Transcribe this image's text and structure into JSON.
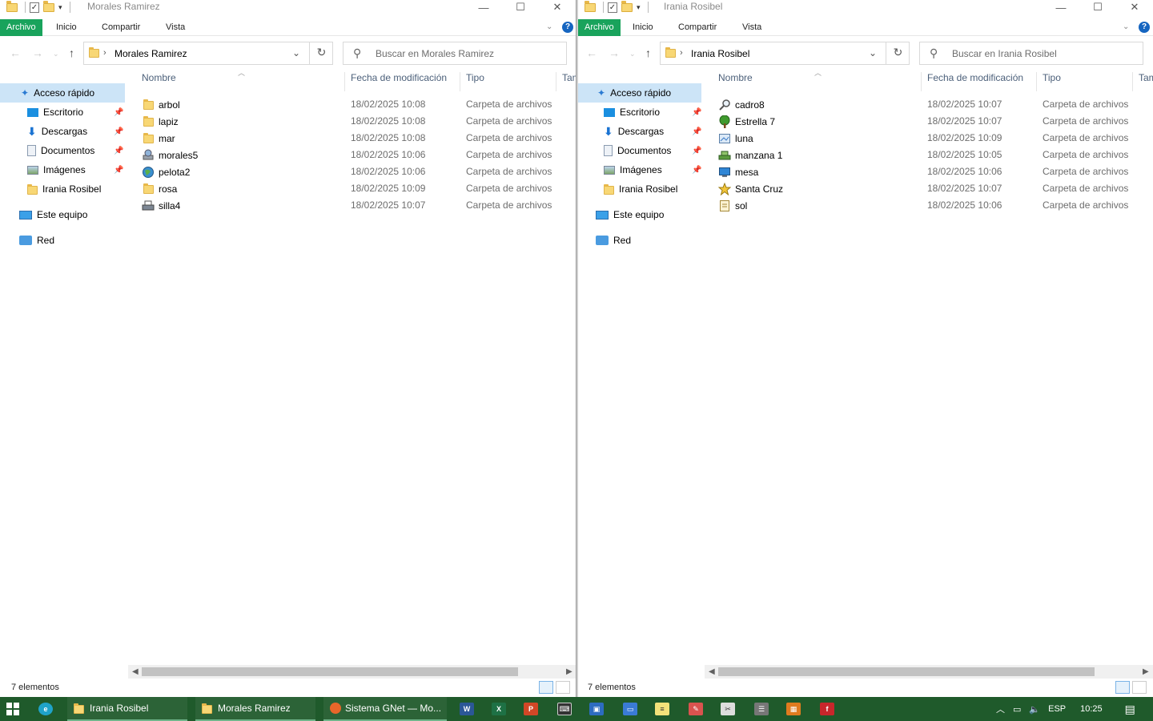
{
  "left": {
    "title": "Morales Ramirez",
    "ribbon": {
      "file": "Archivo",
      "home": "Inicio",
      "share": "Compartir",
      "view": "Vista"
    },
    "address": {
      "path": "Morales Ramirez",
      "search_placeholder": "Buscar en Morales Ramirez"
    },
    "columns": {
      "name": "Nombre",
      "date": "Fecha de modificación",
      "type": "Tipo",
      "size": "Tam"
    },
    "files": [
      {
        "name": "arbol",
        "date": "18/02/2025 10:08",
        "type": "Carpeta de archivos",
        "icon": "folder-icon"
      },
      {
        "name": "lapiz",
        "date": "18/02/2025 10:08",
        "type": "Carpeta de archivos",
        "icon": "folder-icon"
      },
      {
        "name": "mar",
        "date": "18/02/2025 10:08",
        "type": "Carpeta de archivos",
        "icon": "folder-icon"
      },
      {
        "name": "morales5",
        "date": "18/02/2025 10:06",
        "type": "Carpeta de archivos",
        "icon": "network-drive-icon"
      },
      {
        "name": "pelota2",
        "date": "18/02/2025 10:06",
        "type": "Carpeta de archivos",
        "icon": "globe-icon"
      },
      {
        "name": "rosa",
        "date": "18/02/2025 10:09",
        "type": "Carpeta de archivos",
        "icon": "folder-icon"
      },
      {
        "name": "silla4",
        "date": "18/02/2025 10:07",
        "type": "Carpeta de archivos",
        "icon": "printer-icon"
      }
    ],
    "status": "7 elementos"
  },
  "right": {
    "title": "Irania Rosibel",
    "ribbon": {
      "file": "Archivo",
      "home": "Inicio",
      "share": "Compartir",
      "view": "Vista"
    },
    "address": {
      "path": "Irania Rosibel",
      "search_placeholder": "Buscar en Irania Rosibel"
    },
    "columns": {
      "name": "Nombre",
      "date": "Fecha de modificación",
      "type": "Tipo",
      "size": "Tam"
    },
    "files": [
      {
        "name": "cadro8",
        "date": "18/02/2025 10:07",
        "type": "Carpeta de archivos",
        "icon": "magnifier-icon"
      },
      {
        "name": "Estrella 7",
        "date": "18/02/2025 10:07",
        "type": "Carpeta de archivos",
        "icon": "tree-icon"
      },
      {
        "name": "luna",
        "date": "18/02/2025 10:09",
        "type": "Carpeta de archivos",
        "icon": "image-file-icon"
      },
      {
        "name": "manzana 1",
        "date": "18/02/2025 10:05",
        "type": "Carpeta de archivos",
        "icon": "network-computers-icon"
      },
      {
        "name": "mesa",
        "date": "18/02/2025 10:06",
        "type": "Carpeta de archivos",
        "icon": "monitor-icon"
      },
      {
        "name": "Santa Cruz",
        "date": "18/02/2025 10:07",
        "type": "Carpeta de archivos",
        "icon": "star-icon"
      },
      {
        "name": "sol",
        "date": "18/02/2025 10:06",
        "type": "Carpeta de archivos",
        "icon": "document-folder-icon"
      }
    ],
    "status": "7 elementos"
  },
  "nav": {
    "quick_access": "Acceso rápido",
    "desktop": "Escritorio",
    "downloads": "Descargas",
    "documents": "Documentos",
    "images": "Imágenes",
    "user_folder": "Irania Rosibel",
    "this_pc": "Este equipo",
    "network": "Red"
  },
  "taskbar": {
    "tasks": [
      "Irania Rosibel",
      "Morales Ramirez",
      "Sistema GNet — Mo..."
    ],
    "language": "ESP",
    "time": "10:25"
  },
  "colors": {
    "file_tab": "#19a35c",
    "taskbar": "#1f5a2b",
    "nav_selected": "#cce4f7",
    "folder": "#f8d775"
  }
}
